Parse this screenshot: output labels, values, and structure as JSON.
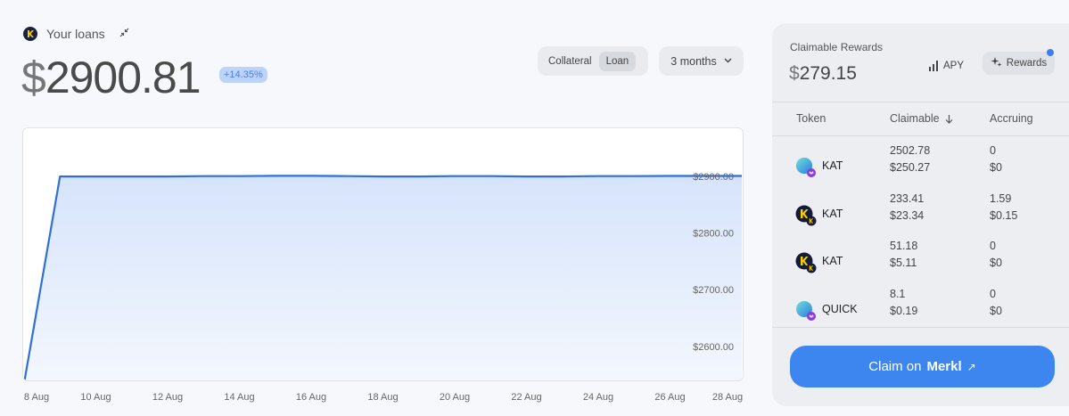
{
  "loans": {
    "title": "Your loans",
    "currency_symbol": "$",
    "amount": "2900.81",
    "change": "+14.35%",
    "toggle": {
      "collateral": "Collateral",
      "loan": "Loan",
      "active": "Loan"
    },
    "range": "3 months"
  },
  "chart_data": {
    "type": "area",
    "x": [
      "8 Aug",
      "9 Aug",
      "10 Aug",
      "11 Aug",
      "12 Aug",
      "13 Aug",
      "14 Aug",
      "15 Aug",
      "16 Aug",
      "17 Aug",
      "18 Aug",
      "19 Aug",
      "20 Aug",
      "21 Aug",
      "22 Aug",
      "23 Aug",
      "24 Aug",
      "25 Aug",
      "26 Aug",
      "27 Aug",
      "28 Aug"
    ],
    "values": [
      2535,
      2900,
      2900,
      2900,
      2900,
      2900.5,
      2900.5,
      2901,
      2901,
      2900.5,
      2900,
      2900,
      2900.5,
      2900.5,
      2900,
      2900,
      2900.5,
      2900.5,
      2900.8,
      2900.8,
      2900.81
    ],
    "xticks": [
      "8 Aug",
      "10 Aug",
      "12 Aug",
      "14 Aug",
      "16 Aug",
      "18 Aug",
      "20 Aug",
      "22 Aug",
      "24 Aug",
      "26 Aug",
      "28 Aug"
    ],
    "yticks": [
      2900,
      2800,
      2700,
      2600
    ],
    "ytick_labels": [
      "$2900.00",
      "$2800.00",
      "$2700.00",
      "$2600.00"
    ],
    "ylim": [
      2540,
      2985
    ],
    "baseline": 2540,
    "line_color": "#2f6fdc",
    "fill_color": "#d6e4fb",
    "grid": false
  },
  "rewards": {
    "label": "Claimable Rewards",
    "currency_symbol": "$",
    "amount": "279.15",
    "apy_label": "APY",
    "rewards_label": "Rewards",
    "columns": {
      "token": "Token",
      "claimable": "Claimable",
      "accruing": "Accruing"
    },
    "rows": [
      {
        "icon": "kat-lp-icon",
        "token": "KAT",
        "claimable": "2502.78",
        "claimable_usd": "$250.27",
        "accruing": "0",
        "accruing_usd": "$0"
      },
      {
        "icon": "kat-pair-icon",
        "token": "KAT",
        "claimable": "233.41",
        "claimable_usd": "$23.34",
        "accruing": "1.59",
        "accruing_usd": "$0.15"
      },
      {
        "icon": "kat-pair-icon",
        "token": "KAT",
        "claimable": "51.18",
        "claimable_usd": "$5.11",
        "accruing": "0",
        "accruing_usd": "$0"
      },
      {
        "icon": "quick-lp-icon",
        "token": "QUICK",
        "claimable": "8.1",
        "claimable_usd": "$0.19",
        "accruing": "0",
        "accruing_usd": "$0"
      }
    ],
    "claim_prefix": "Claim on",
    "claim_brand": "Merkl",
    "claim_arrow": "↗",
    "accent": "#3d86f0"
  }
}
